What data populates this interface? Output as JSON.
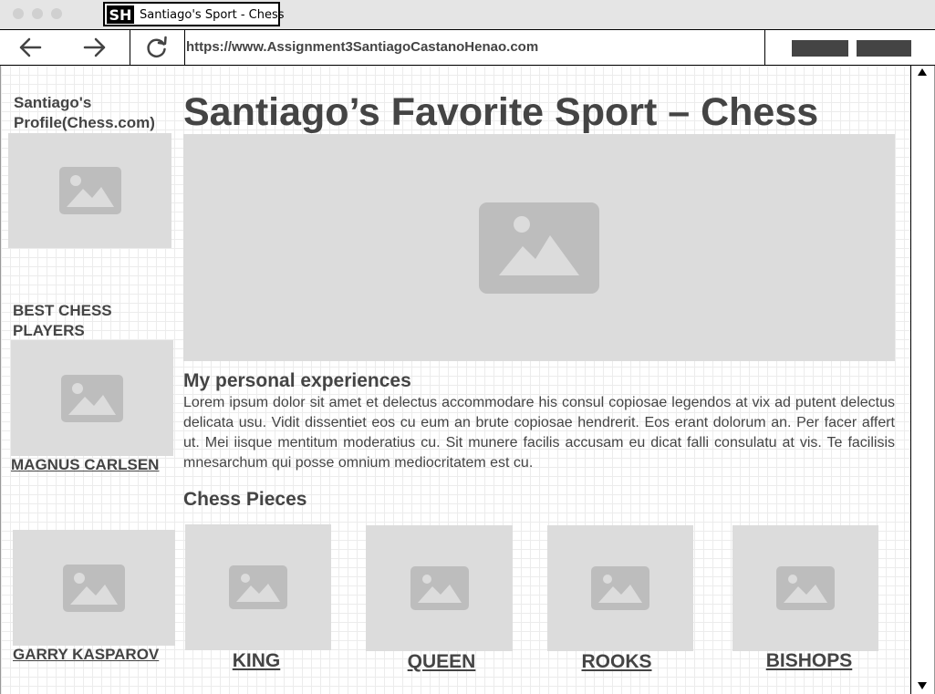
{
  "browser": {
    "tab_title": "Santiago's Sport - Chess",
    "tab_logo_text": "SH",
    "url": "https://www.Assignment3SantiagoCastanoHenao.com",
    "nav": {
      "back_icon": "arrow-left-icon",
      "forward_icon": "arrow-right-icon",
      "reload_icon": "reload-icon"
    }
  },
  "sidebar": {
    "profile_heading": "Santiago's Profile(Chess.com)",
    "players_heading": "BEST CHESS PLAYERS",
    "players": [
      {
        "name": "MAGNUS CARLSEN"
      },
      {
        "name": "GARRY KASPAROV"
      }
    ]
  },
  "main": {
    "title": "Santiago’s Favorite Sport – Chess",
    "experiences_heading": "My personal experiences",
    "experiences_text": "Lorem ipsum dolor sit amet et delectus accommodare his consul copiosae legendos at vix ad putent delectus delicata usu. Vidit dissentiet eos cu eum an brute copiosae hendrerit. Eos erant dolorum an. Per facer affert ut. Mei iisque mentitum moderatius cu. Sit munere facilis accusam eu dicat falli consulatu at vis. Te facilisis mnesarchum qui posse omnium mediocritatem est cu.",
    "pieces_heading": "Chess Pieces",
    "pieces": [
      {
        "label": "KING"
      },
      {
        "label": "QUEEN"
      },
      {
        "label": "ROOKS"
      },
      {
        "label": "BISHOPS"
      }
    ]
  },
  "colors": {
    "placeholder_bg": "#dcdcdc",
    "placeholder_icon": "#bdbdbd",
    "text": "#444444",
    "grid": "#ececec"
  }
}
